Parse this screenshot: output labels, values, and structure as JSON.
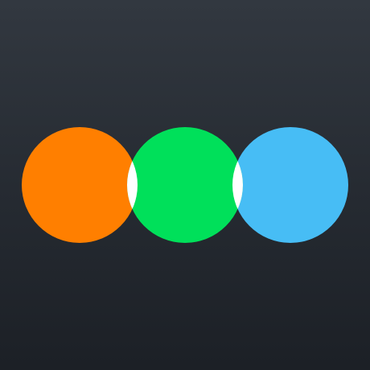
{
  "app_icon": {
    "icon": "three-overlapping-circles-logo",
    "colors": {
      "background_top": "#323840",
      "background_bottom": "#1c2026",
      "circle_left": "#ff7f00",
      "circle_middle": "#00e05a",
      "circle_right": "#47bdf5",
      "overlap": "#ffffff"
    }
  }
}
